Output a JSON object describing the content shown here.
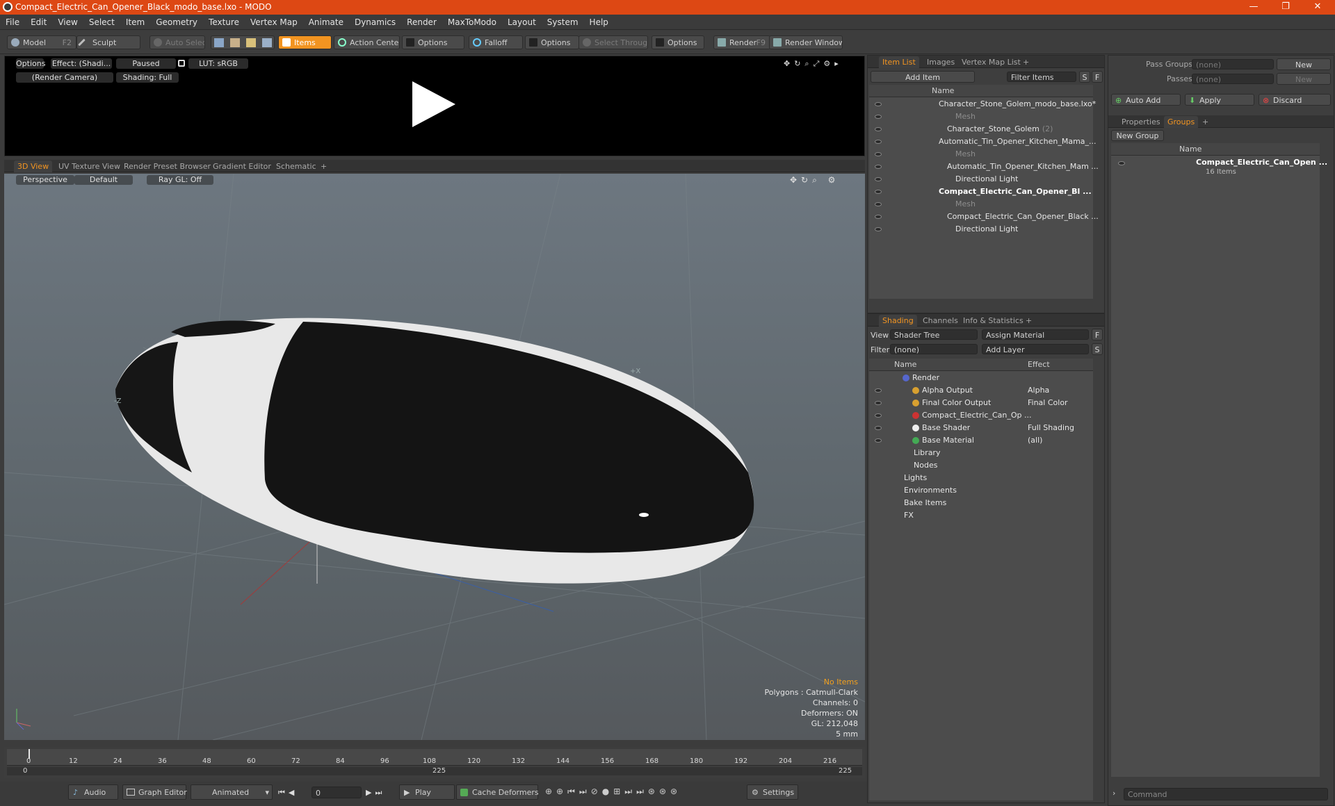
{
  "window": {
    "title": "Compact_Electric_Can_Opener_Black_modo_base.lxo - MODO",
    "minimize": "—",
    "restore": "❐",
    "close": "✕"
  },
  "menu": [
    "File",
    "Edit",
    "View",
    "Select",
    "Item",
    "Geometry",
    "Texture",
    "Vertex Map",
    "Animate",
    "Dynamics",
    "Render",
    "MaxToModo",
    "Layout",
    "System",
    "Help"
  ],
  "toolbar": {
    "model": "Model",
    "model_key": "F2",
    "sculpt": "Sculpt",
    "auto_select": "Auto Select",
    "items": "Items",
    "action_center": "Action Center",
    "options1": "Options",
    "falloff": "Falloff",
    "options2": "Options",
    "select_through": "Select Through",
    "options3": "Options",
    "render": "Render",
    "render_key": "F9",
    "render_window": "Render Window"
  },
  "preview": {
    "options": "Options",
    "effect": "Effect: (Shadi...",
    "paused": "Paused",
    "lut": "LUT: sRGB",
    "camera": "(Render Camera)",
    "shading": "Shading: Full"
  },
  "viewport_tabs": [
    "3D View",
    "UV Texture View",
    "Render Preset Browser",
    "Gradient Editor",
    "Schematic",
    "+"
  ],
  "viewport": {
    "perspective": "Perspective",
    "default": "Default",
    "raygl": "Ray GL: Off",
    "axis_x": "+X",
    "axis_z": "-Z",
    "stats": {
      "no_items": "No Items",
      "polygons": "Polygons : Catmull-Clark",
      "channels": "Channels: 0",
      "deformers": "Deformers: ON",
      "gl": "GL: 212,048",
      "scale": "5 mm"
    }
  },
  "timeline": {
    "ticks": [
      "0",
      "12",
      "24",
      "36",
      "48",
      "60",
      "72",
      "84",
      "96",
      "108",
      "120",
      "132",
      "144",
      "156",
      "168",
      "180",
      "192",
      "204",
      "216"
    ],
    "start": "0",
    "mid": "225",
    "end": "225"
  },
  "bottom": {
    "audio": "Audio",
    "graph_editor": "Graph Editor",
    "animated": "Animated",
    "frame": "0",
    "play": "Play",
    "cache_deformers": "Cache Deformers",
    "settings": "Settings"
  },
  "itemlist": {
    "tabs": [
      "Item List",
      "Images",
      "Vertex Map List",
      "+"
    ],
    "add_item": "Add Item",
    "filter": "Filter Items",
    "s": "S",
    "f": "F",
    "col_name": "Name",
    "rows": [
      {
        "label": "Character_Stone_Golem_modo_base.lxo*",
        "style": "",
        "indent": 0
      },
      {
        "label": "Mesh",
        "style": "dim",
        "indent": 2
      },
      {
        "label": "Character_Stone_Golem",
        "suffix": "(2)",
        "style": "",
        "indent": 1
      },
      {
        "label": "Automatic_Tin_Opener_Kitchen_Mama_...",
        "style": "",
        "indent": 0
      },
      {
        "label": "Mesh",
        "style": "dim",
        "indent": 2
      },
      {
        "label": "Automatic_Tin_Opener_Kitchen_Mam ...",
        "style": "",
        "indent": 1
      },
      {
        "label": "Directional Light",
        "style": "",
        "indent": 2
      },
      {
        "label": "Compact_Electric_Can_Opener_Bl ...",
        "style": "bold",
        "indent": 0
      },
      {
        "label": "Mesh",
        "style": "dim",
        "indent": 2
      },
      {
        "label": "Compact_Electric_Can_Opener_Black ...",
        "style": "",
        "indent": 1
      },
      {
        "label": "Directional Light",
        "style": "",
        "indent": 2
      }
    ]
  },
  "shading": {
    "tabs": [
      "Shading",
      "Channels",
      "Info & Statistics",
      "+"
    ],
    "view_label": "View",
    "view_value": "Shader Tree",
    "assign": "Assign Material",
    "f": "F",
    "filter_label": "Filter",
    "filter_value": "(none)",
    "add_layer": "Add Layer",
    "s": "S",
    "col_name": "Name",
    "col_effect": "Effect",
    "rows": [
      {
        "label": "Render",
        "effect": "",
        "indent": 0
      },
      {
        "label": "Alpha Output",
        "effect": "Alpha",
        "indent": 1
      },
      {
        "label": "Final Color Output",
        "effect": "Final Color",
        "indent": 1
      },
      {
        "label": "Compact_Electric_Can_Op ...",
        "effect": "",
        "indent": 1
      },
      {
        "label": "Base Shader",
        "effect": "Full Shading",
        "indent": 1
      },
      {
        "label": "Base Material",
        "effect": "(all)",
        "indent": 1
      },
      {
        "label": "Library",
        "effect": "",
        "indent": 2
      },
      {
        "label": "Nodes",
        "effect": "",
        "indent": 2
      },
      {
        "label": "Lights",
        "effect": "",
        "indent": 3
      },
      {
        "label": "Environments",
        "effect": "",
        "indent": 3
      },
      {
        "label": "Bake Items",
        "effect": "",
        "indent": 4
      },
      {
        "label": "FX",
        "effect": "",
        "indent": 5
      }
    ]
  },
  "groups": {
    "pass_groups": "Pass Groups",
    "passes": "Passes",
    "none": "(none)",
    "new": "New",
    "auto_add": "Auto Add",
    "apply": "Apply",
    "discard": "Discard",
    "tabs": [
      "Properties",
      "Groups",
      "+"
    ],
    "new_group": "New Group",
    "col_name": "Name",
    "item": "Compact_Electric_Can_Open ...",
    "item_count": "16 Items"
  },
  "command": {
    "placeholder": "Command"
  }
}
